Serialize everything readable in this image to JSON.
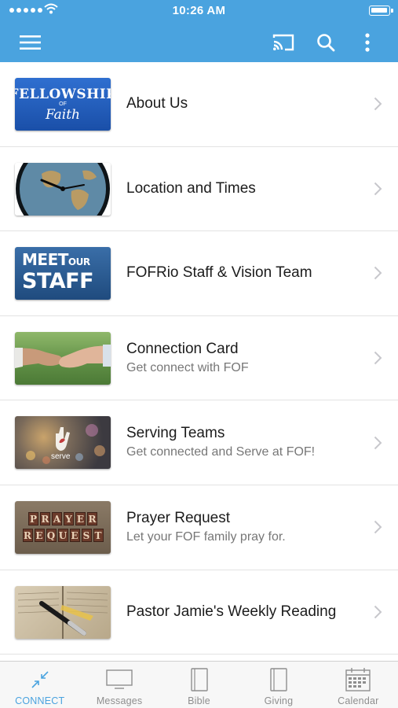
{
  "status_bar": {
    "time": "10:26 AM"
  },
  "colors": {
    "accent": "#4aa3df",
    "tab_inactive": "#8e8e8e"
  },
  "app_bar": {
    "icons": [
      "hamburger-menu-icon",
      "cast-icon",
      "search-icon",
      "more-vertical-icon"
    ]
  },
  "list": [
    {
      "title": "About Us",
      "subtitle": "",
      "thumb": "fellowship-of-faith-logo",
      "thumb_text": {
        "line1": "FELLOWSHIP",
        "line2": "OF",
        "line3": "Faith"
      }
    },
    {
      "title": "Location and Times",
      "subtitle": "",
      "thumb": "world-map-clock"
    },
    {
      "title": "FOFRio Staff & Vision Team",
      "subtitle": "",
      "thumb": "meet-our-staff-banner",
      "thumb_text": {
        "line1a": "MEET",
        "line1b": "OUR",
        "line2": "STAFF"
      }
    },
    {
      "title": "Connection Card",
      "subtitle": "Get connect with FOF",
      "thumb": "handshake-photo"
    },
    {
      "title": "Serving Teams",
      "subtitle": "Get connected and Serve at FOF!",
      "thumb": "serve-hand-photo",
      "thumb_text": {
        "label": "serve"
      }
    },
    {
      "title": "Prayer Request",
      "subtitle": "Let your FOF family pray for.",
      "thumb": "prayer-request-letterpress",
      "thumb_text": {
        "word1": "PRAYER",
        "word2": "REQUEST"
      }
    },
    {
      "title": "Pastor Jamie's Weekly Reading",
      "subtitle": "",
      "thumb": "open-bible-pen-photo"
    }
  ],
  "tabs": [
    {
      "label": "CONNECT",
      "icon": "connect-arrows-icon",
      "active": true
    },
    {
      "label": "Messages",
      "icon": "monitor-icon",
      "active": false
    },
    {
      "label": "Bible",
      "icon": "book-icon",
      "active": false
    },
    {
      "label": "Giving",
      "icon": "wallet-icon",
      "active": false
    },
    {
      "label": "Calendar",
      "icon": "calendar-icon",
      "active": false
    }
  ]
}
